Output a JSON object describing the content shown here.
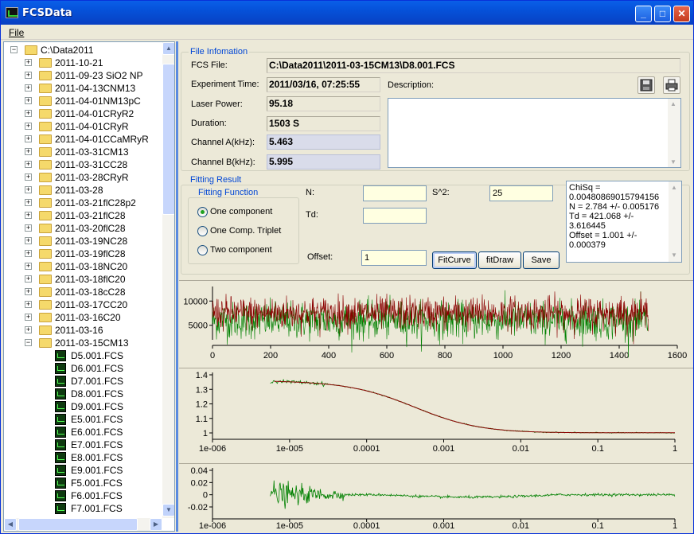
{
  "window": {
    "title": "FCSData",
    "min": "_",
    "max": "□",
    "close": "✕"
  },
  "menu": {
    "file": "File"
  },
  "tree": {
    "root": "C:\\Data2011",
    "folders": [
      "2011-10-21",
      "2011-09-23 SiO2 NP",
      "2011-04-13CNM13",
      "2011-04-01NM13pC",
      "2011-04-01CRyR2",
      "2011-04-01CRyR",
      "2011-04-01CCaMRyR",
      "2011-03-31CM13",
      "2011-03-31CC28",
      "2011-03-28CRyR",
      "2011-03-28",
      "2011-03-21flC28p2",
      "2011-03-21flC28",
      "2011-03-20flC28",
      "2011-03-19NC28",
      "2011-03-19flC28",
      "2011-03-18NC20",
      "2011-03-18flC20",
      "2011-03-18cC28",
      "2011-03-17CC20",
      "2011-03-16C20",
      "2011-03-16"
    ],
    "open_folder": "2011-03-15CM13",
    "files": [
      "D5.001.FCS",
      "D6.001.FCS",
      "D7.001.FCS",
      "D8.001.FCS",
      "D9.001.FCS",
      "E5.001.FCS",
      "E6.001.FCS",
      "E7.001.FCS",
      "E8.001.FCS",
      "E9.001.FCS",
      "F5.001.FCS",
      "F6.001.FCS",
      "F7.001.FCS"
    ]
  },
  "file_info": {
    "group_title": "File Infomation",
    "fcs_file_label": "FCS File:",
    "fcs_file": "C:\\Data2011\\2011-03-15CM13\\D8.001.FCS",
    "exp_time_label": "Experiment Time:",
    "exp_time": "2011/03/16, 07:25:55",
    "laser_label": "Laser Power:",
    "laser": "95.18",
    "duration_label": "Duration:",
    "duration": "1503 S",
    "chA_label": "Channel A(kHz):",
    "chA": "5.463",
    "chB_label": "Channel B(kHz):",
    "chB": "5.995",
    "description_label": "Description:"
  },
  "fitting": {
    "group_title": "Fitting Result",
    "function_title": "Fitting Function",
    "options": [
      "One component",
      "One Comp. Triplet",
      "Two component"
    ],
    "selected": 0,
    "n_label": "N:",
    "n_value": "",
    "s2_label": "S^2:",
    "s2_value": "25",
    "td_label": "Td:",
    "td_value": "",
    "offset_label": "Offset:",
    "offset_value": "1",
    "btn_fitcurve": "FitCurve",
    "btn_fitdraw": "fitDraw",
    "btn_save": "Save",
    "result_lines": [
      "ChiSq =",
      "0.00480869015794156",
      "N = 2.784 +/- 0.005176",
      "Td = 421.068 +/-",
      "3.616445",
      "Offset = 1.001 +/-",
      "0.000379"
    ]
  },
  "colors": {
    "trace_a": "#8b0000",
    "trace_b": "#008000",
    "fit": "#8b0000"
  },
  "chart_data": [
    {
      "type": "line",
      "title": "",
      "x_ticks": [
        "0",
        "200",
        "400",
        "600",
        "800",
        "1000",
        "1200",
        "1400",
        "1600"
      ],
      "y_ticks": [
        "10000",
        "5000"
      ],
      "xlim": [
        0,
        1600
      ],
      "ylim": [
        2000,
        13000
      ],
      "series": [
        {
          "values": "dense noisy intensity trace ~5000-10000 over 0-1500"
        }
      ]
    },
    {
      "type": "line",
      "x_scale": "log",
      "x_ticks": [
        "1e-006",
        "1e-005",
        "0.0001",
        "0.001",
        "0.01",
        "0.1",
        "1"
      ],
      "y_ticks": [
        "1.4",
        "1.3",
        "1.2",
        "1.1",
        "1"
      ],
      "ylim": [
        0.98,
        1.42
      ],
      "N": 2.784,
      "Td": 421.068,
      "Offset": 1.001
    },
    {
      "type": "line",
      "x_scale": "log",
      "x_ticks": [
        "1e-006",
        "1e-005",
        "0.0001",
        "0.001",
        "0.01",
        "0.1",
        "1"
      ],
      "y_ticks": [
        "0.04",
        "0.02",
        "0",
        "-0.02"
      ],
      "ylim": [
        -0.03,
        0.045
      ]
    }
  ]
}
